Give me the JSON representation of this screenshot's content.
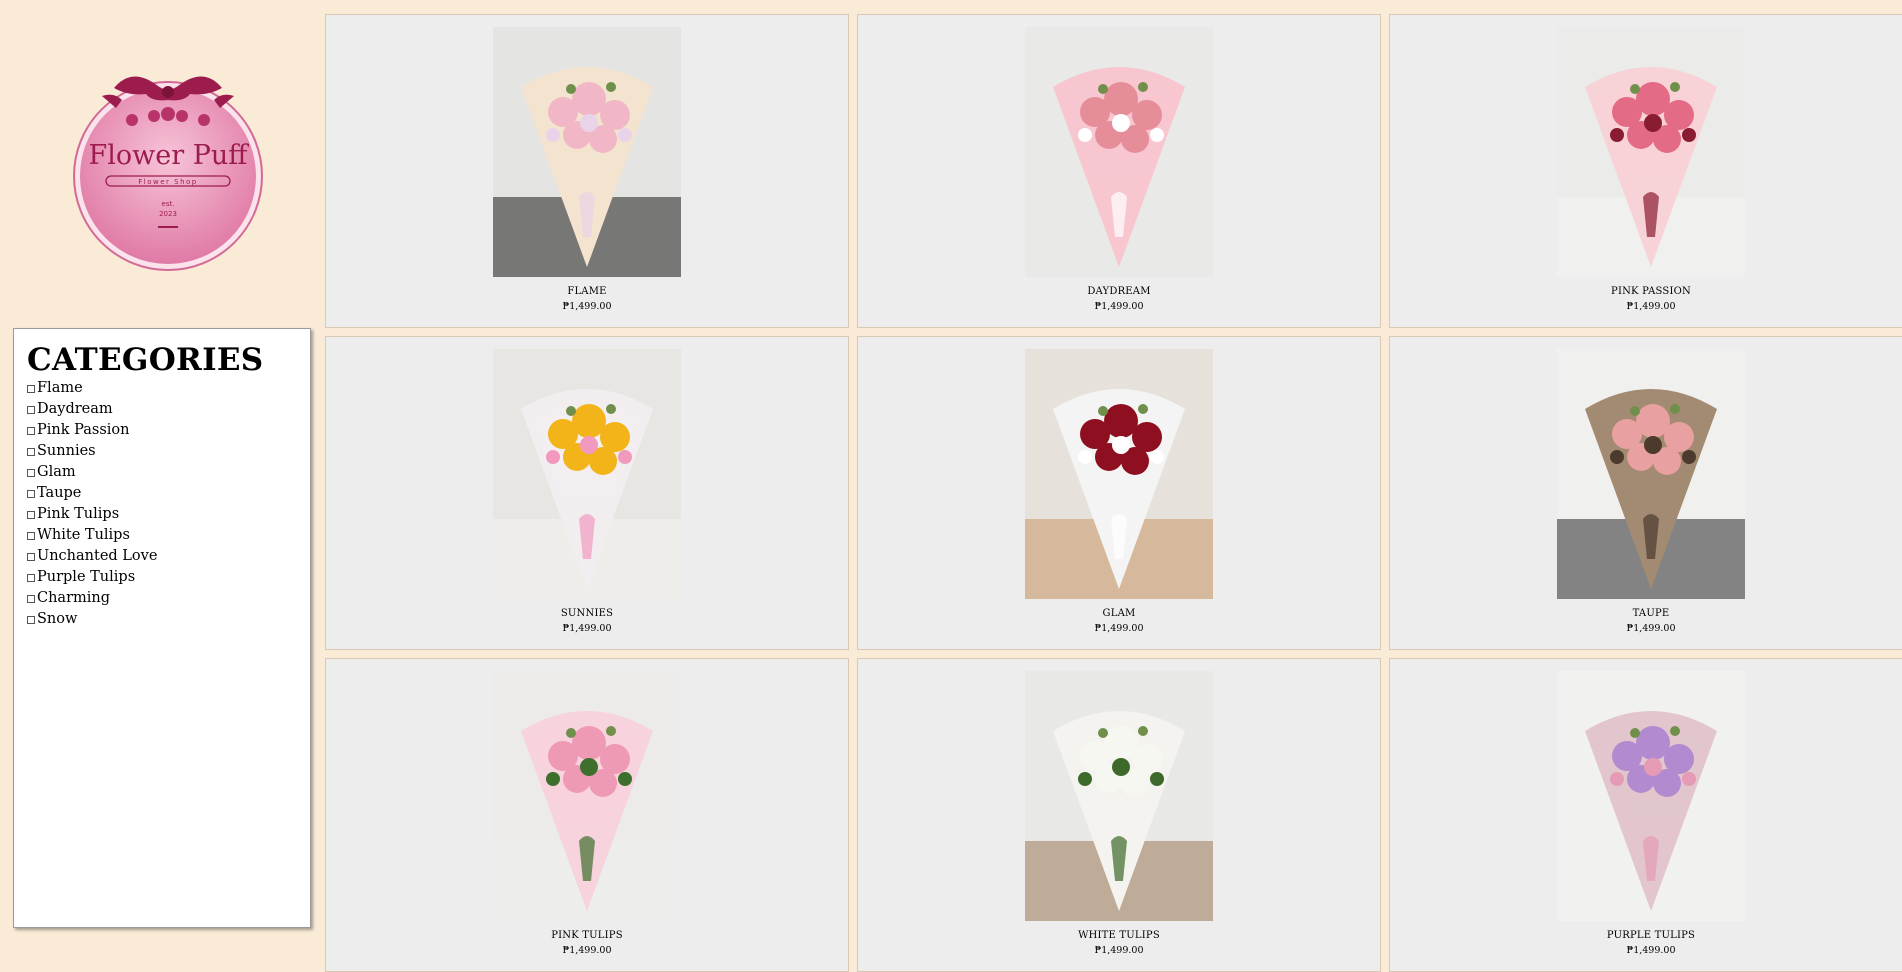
{
  "brand": {
    "logo_name": "Flower Puff",
    "logo_sub": "Flower Shop",
    "logo_est": "est.",
    "logo_year": "2023"
  },
  "sidebar": {
    "title": "CATEGORIES",
    "items": [
      {
        "label": "Flame"
      },
      {
        "label": "Daydream"
      },
      {
        "label": "Pink Passion"
      },
      {
        "label": "Sunnies"
      },
      {
        "label": "Glam"
      },
      {
        "label": "Taupe"
      },
      {
        "label": "Pink Tulips"
      },
      {
        "label": "White Tulips"
      },
      {
        "label": "Unchanted Love"
      },
      {
        "label": "Purple Tulips"
      },
      {
        "label": "Charming"
      },
      {
        "label": "Snow"
      }
    ]
  },
  "products": [
    {
      "name": "FLAME",
      "price": "₱1,499.00",
      "bg": "#e4e4e2",
      "wrap": "#f3e3cf",
      "flower": "#f2b7c6",
      "accent": "#e9d3e8",
      "base": "#1e1e1e"
    },
    {
      "name": "DAYDREAM",
      "price": "₱1,499.00",
      "bg": "#e9e9e7",
      "wrap": "#f7c6cf",
      "flower": "#e58d98",
      "accent": "#ffffff",
      "base": "#e9e9e7"
    },
    {
      "name": "PINK PASSION",
      "price": "₱1,499.00",
      "bg": "#ebebea",
      "wrap": "#f7d2d6",
      "flower": "#e46b85",
      "accent": "#8a1c32",
      "base": "#f4f4f2"
    },
    {
      "name": "SUNNIES",
      "price": "₱1,499.00",
      "bg": "#e8e6e3",
      "wrap": "#f2eef0",
      "flower": "#f2b418",
      "accent": "#f19abd",
      "base": "#f4f2ef"
    },
    {
      "name": "GLAM",
      "price": "₱1,499.00",
      "bg": "#e7e1dc",
      "wrap": "#f4f4f4",
      "flower": "#8e1020",
      "accent": "#ffffff",
      "base": "#c99867"
    },
    {
      "name": "TAUPE",
      "price": "₱1,499.00",
      "bg": "#f0f0ef",
      "wrap": "#a38a72",
      "flower": "#e8a0a0",
      "accent": "#4c3a2d",
      "base": "#2a2a2a"
    },
    {
      "name": "PINK TULIPS",
      "price": "₱1,499.00",
      "bg": "#ecebe9",
      "wrap": "#f7d3dd",
      "flower": "#ef9ab5",
      "accent": "#3e6f2c",
      "base": "#eeeeee"
    },
    {
      "name": "WHITE TULIPS",
      "price": "₱1,499.00",
      "bg": "#e8e8e6",
      "wrap": "#f5f3ef",
      "flower": "#f7f7f2",
      "accent": "#3d6a2a",
      "base": "#9a7a5a"
    },
    {
      "name": "PURPLE TULIPS",
      "price": "₱1,499.00",
      "bg": "#f1f1f0",
      "wrap": "#e2c5cd",
      "flower": "#b18ad0",
      "accent": "#e59bb5",
      "base": "#f1f1f0"
    }
  ],
  "colors": {
    "page_bg": "#faebd7",
    "card_bg": "#ededed",
    "logo_pink": "#e78fb5",
    "logo_dark": "#9c1d4d"
  }
}
